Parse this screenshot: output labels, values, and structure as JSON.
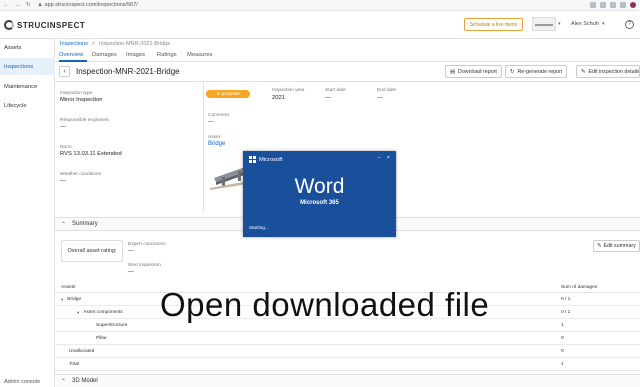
{
  "browser": {
    "url": "app.strucinspect.com/inspections/567/"
  },
  "header": {
    "logo": "STRUCINSPECT",
    "demo_button": "Schedule a live demo",
    "user_name": "Alex Schuh",
    "help": "?"
  },
  "sidebar": {
    "items": [
      {
        "label": "Assets"
      },
      {
        "label": "Inspections"
      },
      {
        "label": "Maintenance"
      },
      {
        "label": "Lifecycle"
      }
    ],
    "admin": "Admin console"
  },
  "breadcrumb": {
    "root": "Inspections",
    "separator": ">",
    "current": "Inspection-MNR-2021-Bridge"
  },
  "tabs": [
    "Overview",
    "Damages",
    "Images",
    "Ratings",
    "Measures"
  ],
  "title": "Inspection-MNR-2021-Bridge",
  "actions": {
    "download": "Download report",
    "regenerate": "Re-generate report",
    "edit": "Edit inspection details"
  },
  "details": {
    "type_label": "Inspection type",
    "type_value": "Minor Inspection",
    "engineers_label": "Responsible engineers",
    "engineers_value": "—",
    "norm_label": "Norm",
    "norm_value": "RVS 13.03.11 Extended",
    "weather_label": "Weather conditions",
    "weather_value": "—",
    "status": "In progress",
    "year_label": "Inspection year",
    "year_value": "2021",
    "start_label": "Start date",
    "start_value": "—",
    "end_label": "End date",
    "end_value": "—",
    "comment_label": "Comment",
    "comment_value": "—",
    "asset_label": "Asset",
    "asset_value": "Bridge"
  },
  "summary": {
    "title": "Summary",
    "rating_box": "Overall asset rating:",
    "expert_label": "Expert conclusion",
    "expert_value": "—",
    "next_label": "Next inspection",
    "next_value": "—",
    "edit": "Edit summary"
  },
  "table": {
    "col_assets": "Assets",
    "col_sum": "Sum of damages",
    "rows": [
      {
        "name": "Bridge",
        "value": "0 / 1"
      },
      {
        "name": "Asset components",
        "value": "0 / 1"
      },
      {
        "name": "Superstructure",
        "value": "1"
      },
      {
        "name": "Pillar",
        "value": "0"
      },
      {
        "name": "Unallocated",
        "value": "0"
      },
      {
        "name": "Total",
        "value": "1"
      }
    ]
  },
  "model_section": "3D Model",
  "splash": {
    "vendor": "Microsoft",
    "app": "Word",
    "suite": "Microsoft 365",
    "status": "Starting..."
  },
  "overlay_caption": "Open downloaded file",
  "colors": {
    "accent": "#1565c0",
    "status": "#f5a623",
    "splash": "#1a4f9c",
    "demo": "#e5a339"
  }
}
